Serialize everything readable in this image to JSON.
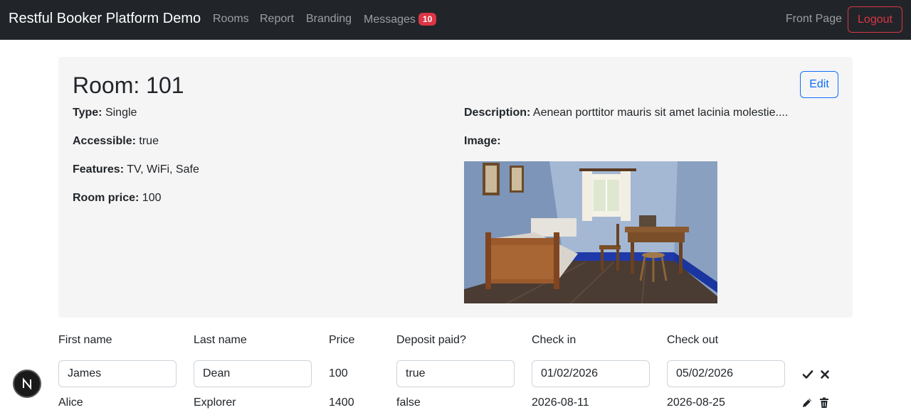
{
  "nav": {
    "brand": "Restful Booker Platform Demo",
    "links": [
      "Rooms",
      "Report",
      "Branding",
      "Messages"
    ],
    "messages_count": "10",
    "front_page": "Front Page",
    "logout": "Logout"
  },
  "room": {
    "title": "Room: 101",
    "edit_label": "Edit",
    "type_label": "Type:",
    "type": "Single",
    "accessible_label": "Accessible:",
    "accessible": "true",
    "features_label": "Features:",
    "features": "TV, WiFi, Safe",
    "price_label": "Room price:",
    "price": "100",
    "description_label": "Description:",
    "description": "Aenean porttitor mauris sit amet lacinia molestie....",
    "image_label": "Image:"
  },
  "bookings": {
    "headers": [
      "First name",
      "Last name",
      "Price",
      "Deposit paid?",
      "Check in",
      "Check out"
    ],
    "edit_row": {
      "firstname": "James",
      "lastname": "Dean",
      "price": "100",
      "deposit": "true",
      "checkin": "01/02/2026",
      "checkout": "05/02/2026"
    },
    "rows": [
      {
        "firstname": "Alice",
        "lastname": "Explorer",
        "price": "1400",
        "deposit": "false",
        "checkin": "2026-08-11",
        "checkout": "2026-08-25"
      }
    ]
  },
  "icons": {
    "confirm": "check-icon",
    "cancel": "close-icon",
    "edit": "pencil-icon",
    "delete": "trash-icon",
    "fab": "n-logo-icon"
  },
  "colors": {
    "navbar": "#212529",
    "badge": "#dc3545",
    "primary": "#0d6efd",
    "danger": "#dc3545",
    "card": "#f5f5f5"
  }
}
